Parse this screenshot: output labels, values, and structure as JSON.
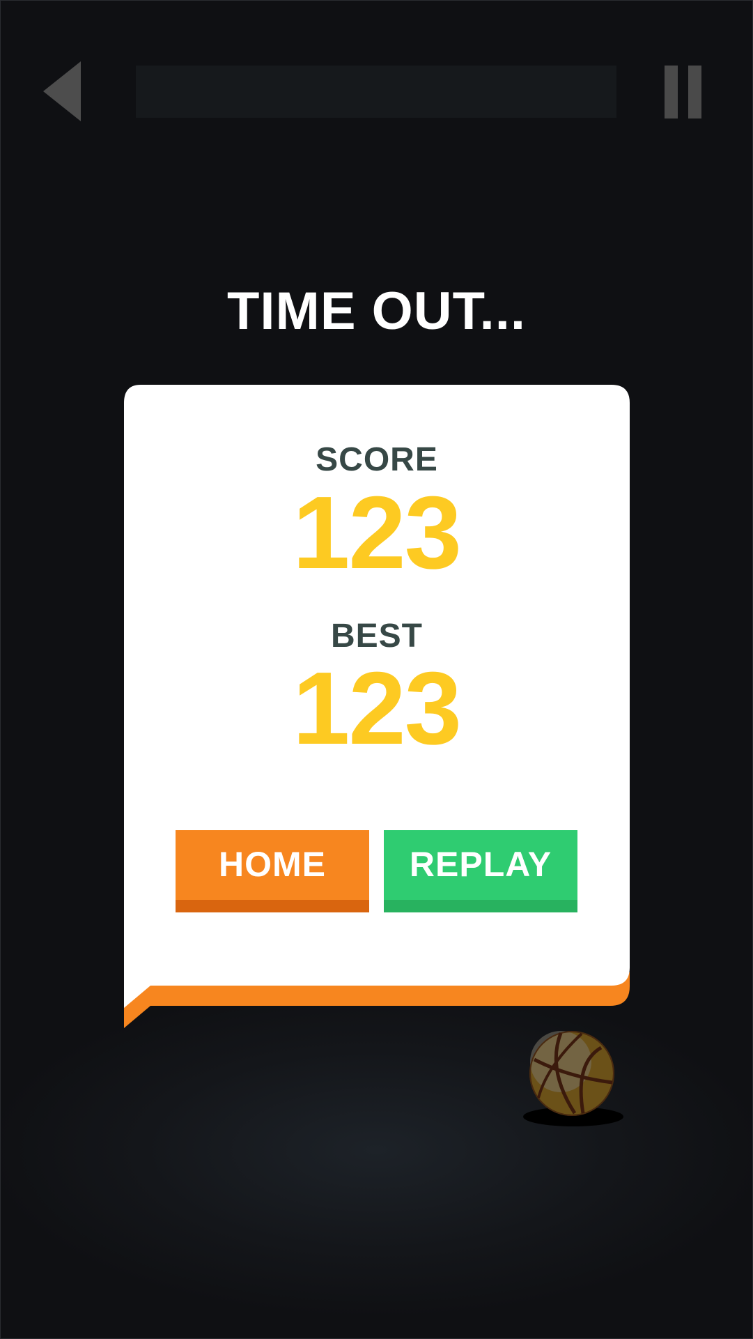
{
  "header": {
    "back_icon": "back-triangle-icon",
    "pause_icon": "pause-icon"
  },
  "game_over": {
    "title": "TIME OUT...",
    "score_label": "SCORE",
    "score_value": "123",
    "best_label": "BEST",
    "best_value": "123"
  },
  "buttons": {
    "home_label": "HOME",
    "replay_label": "REPLAY"
  },
  "decor": {
    "ball_icon": "basketball-icon"
  },
  "colors": {
    "background": "#0f1013",
    "title": "#ffffff",
    "label": "#374846",
    "value": "#fdca22",
    "home_button": "#f7861f",
    "replay_button": "#2fcc71",
    "card": "#ffffff",
    "card_accent": "#f7861f"
  }
}
